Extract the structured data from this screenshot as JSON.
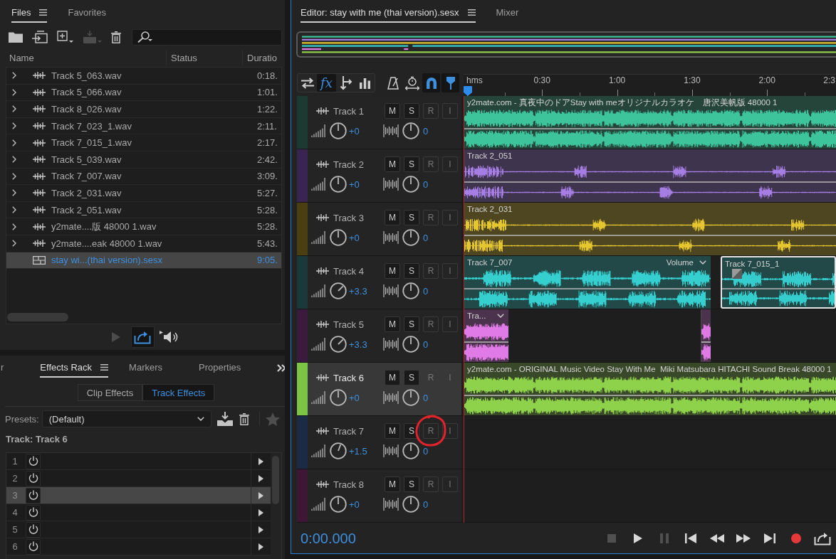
{
  "files_panel": {
    "tabs": [
      {
        "label": "Files",
        "selected": true
      },
      {
        "label": "Favorites",
        "selected": false
      }
    ],
    "toolbar": [
      {
        "kind": "open",
        "disabled": false
      },
      {
        "kind": "import",
        "disabled": false
      },
      {
        "kind": "new",
        "disabled": false
      },
      {
        "kind": "insert",
        "disabled": true
      },
      {
        "kind": "delete",
        "disabled": false
      }
    ],
    "columns": [
      "Name",
      "Status",
      "Duratio"
    ],
    "rows": [
      {
        "kind": "audio",
        "name": "Track 5_063.wav",
        "duration": "0:18.",
        "selected": false
      },
      {
        "kind": "audio",
        "name": "Track 5_066.wav",
        "duration": "1:01.",
        "selected": false
      },
      {
        "kind": "audio",
        "name": "Track 8_026.wav",
        "duration": "1:22.",
        "selected": false
      },
      {
        "kind": "audio",
        "name": "Track 7_023_1.wav",
        "duration": "2:11.",
        "selected": false
      },
      {
        "kind": "audio",
        "name": "Track 7_015_1.wav",
        "duration": "2:17.",
        "selected": false
      },
      {
        "kind": "audio",
        "name": "Track 5_039.wav",
        "duration": "2:42.",
        "selected": false
      },
      {
        "kind": "audio",
        "name": "Track 7_007.wav",
        "duration": "3:09.",
        "selected": false
      },
      {
        "kind": "audio",
        "name": "Track 2_031.wav",
        "duration": "5:27.",
        "selected": false
      },
      {
        "kind": "audio",
        "name": "Track 2_051.wav",
        "duration": "5:28.",
        "selected": false
      },
      {
        "kind": "audio",
        "name": "y2mate....版 48000 1.wav",
        "duration": "5:28.",
        "selected": false
      },
      {
        "kind": "audio",
        "name": "y2mate....eak 48000 1.wav",
        "duration": "5:43.",
        "selected": false
      },
      {
        "kind": "session",
        "name": "stay wi...(thai version).sesx",
        "duration": "9:05.",
        "selected": true
      }
    ],
    "preview_buttons": [
      {
        "kind": "play",
        "disabled": true,
        "selected": false
      },
      {
        "kind": "loop",
        "disabled": false,
        "selected": true
      },
      {
        "kind": "autoplay",
        "disabled": false,
        "selected": false
      }
    ]
  },
  "effects_panel": {
    "tabs": [
      {
        "label": "r",
        "selected": false
      },
      {
        "label": "Effects Rack",
        "selected": true
      },
      {
        "label": "Markers",
        "selected": false
      },
      {
        "label": "Properties",
        "selected": false
      }
    ],
    "modes": [
      {
        "label": "Clip Effects",
        "selected": false
      },
      {
        "label": "Track Effects",
        "selected": true
      }
    ],
    "presets": {
      "label": "Presets:",
      "value": "(Default)"
    },
    "target": "Track: Track 6",
    "slots": [
      {
        "number": "1",
        "selected": false
      },
      {
        "number": "2",
        "selected": false
      },
      {
        "number": "3",
        "selected": true
      },
      {
        "number": "4",
        "selected": false
      },
      {
        "number": "5",
        "selected": false
      },
      {
        "number": "6",
        "selected": false
      }
    ]
  },
  "editor": {
    "tabs": [
      {
        "label": "Editor: stay with me (thai version).sesx",
        "selected": true
      },
      {
        "label": "Mixer",
        "selected": false
      }
    ],
    "toolbar": [
      {
        "kind": "swap",
        "selected": false
      },
      {
        "kind": "fx",
        "label": "fx",
        "selected": true
      },
      {
        "kind": "send",
        "selected": false
      },
      {
        "kind": "eq",
        "selected": false
      },
      {
        "kind": "metronome",
        "selected": false
      },
      {
        "kind": "stretch",
        "selected": false
      },
      {
        "kind": "snap",
        "selected": true
      },
      {
        "kind": "marker",
        "selected": true
      }
    ],
    "ruler": [
      "hms",
      "0:30",
      "1:00",
      "1:30",
      "2:00",
      "2:3"
    ],
    "tracks": [
      {
        "name": "Track 1",
        "color": "#1b3a31",
        "selected": false,
        "buttons": [
          {
            "label": "M",
            "disabled": false,
            "circled": false
          },
          {
            "label": "S",
            "disabled": false,
            "circled": false
          },
          {
            "label": "R",
            "disabled": true,
            "circled": false
          },
          {
            "label": "I",
            "disabled": true,
            "circled": false
          }
        ],
        "volume": "+0",
        "pan": "0",
        "clips": [
          {
            "title": "y2mate.com - 真夜中のドアStay with meオリジナルカラオケ　唐沢美帆版 48000 1",
            "color": "#3ec49b",
            "selected": false,
            "dropdown": false
          }
        ]
      },
      {
        "name": "Track 2",
        "color": "#3a2452",
        "selected": false,
        "buttons": [
          {
            "label": "M",
            "disabled": false,
            "circled": false
          },
          {
            "label": "S",
            "disabled": false,
            "circled": false
          },
          {
            "label": "R",
            "disabled": true,
            "circled": false
          },
          {
            "label": "I",
            "disabled": true,
            "circled": false
          }
        ],
        "volume": "+0",
        "pan": "0",
        "clips": [
          {
            "title": "Track 2_051",
            "color": "#a57de3",
            "selected": false,
            "dropdown": false
          }
        ]
      },
      {
        "name": "Track 3",
        "color": "#4b3f12",
        "selected": false,
        "buttons": [
          {
            "label": "M",
            "disabled": false,
            "circled": false
          },
          {
            "label": "S",
            "disabled": false,
            "circled": false
          },
          {
            "label": "R",
            "disabled": true,
            "circled": false
          },
          {
            "label": "I",
            "disabled": true,
            "circled": false
          }
        ],
        "volume": "+0",
        "pan": "0",
        "clips": [
          {
            "title": "Track 2_031",
            "color": "#e6c62e",
            "selected": false,
            "dropdown": false
          }
        ]
      },
      {
        "name": "Track 4",
        "color": "#1a3a3a",
        "selected": false,
        "buttons": [
          {
            "label": "M",
            "disabled": false,
            "circled": false
          },
          {
            "label": "S",
            "disabled": false,
            "circled": false
          },
          {
            "label": "R",
            "disabled": true,
            "circled": false
          },
          {
            "label": "I",
            "disabled": true,
            "circled": false
          }
        ],
        "volume": "+3.3",
        "pan": "0",
        "clips": [
          {
            "title": "Track 7_007",
            "color": "#35cfcf",
            "selected": false,
            "dropdown": true,
            "envelope_label": "Volume"
          },
          {
            "title": "Track 7_015_1",
            "color": "#35cfcf",
            "selected": true,
            "dropdown": false
          }
        ]
      },
      {
        "name": "Track 5",
        "color": "#3b1b3d",
        "selected": false,
        "buttons": [
          {
            "label": "M",
            "disabled": false,
            "circled": false
          },
          {
            "label": "S",
            "disabled": false,
            "circled": false
          },
          {
            "label": "R",
            "disabled": true,
            "circled": false
          },
          {
            "label": "I",
            "disabled": true,
            "circled": false
          }
        ],
        "volume": "+3.3",
        "pan": "0",
        "clips": [
          {
            "title": "Tra...",
            "color": "#e07ae6",
            "selected": false,
            "dropdown": true
          },
          {
            "color": "#e07ae6",
            "selected": false,
            "dropdown": false
          }
        ]
      },
      {
        "name": "Track 6",
        "color": "#7cc544",
        "selected": true,
        "buttons": [
          {
            "label": "M",
            "disabled": false,
            "circled": false
          },
          {
            "label": "S",
            "disabled": false,
            "circled": false
          },
          {
            "label": "R",
            "disabled": true,
            "circled": false
          },
          {
            "label": "I",
            "disabled": true,
            "circled": false
          }
        ],
        "volume": "+0",
        "pan": "0",
        "clips": [
          {
            "title": "y2mate.com - ORIGINAL Music Video Stay With Me  Miki Matsubara HITACHI Sound Break 48000 1",
            "color": "#8ed24b",
            "selected": false,
            "dropdown": false
          }
        ]
      },
      {
        "name": "Track 7",
        "color": "#1b2b45",
        "selected": false,
        "buttons": [
          {
            "label": "M",
            "disabled": false,
            "circled": false
          },
          {
            "label": "S",
            "disabled": false,
            "circled": false
          },
          {
            "label": "R",
            "disabled": true,
            "circled": true
          },
          {
            "label": "I",
            "disabled": true,
            "circled": false
          }
        ],
        "volume": "+1.5",
        "pan": "0"
      },
      {
        "name": "Track 8",
        "color": "#3e1636",
        "selected": false,
        "buttons": [
          {
            "label": "M",
            "disabled": false,
            "circled": false
          },
          {
            "label": "S",
            "disabled": false,
            "circled": false
          },
          {
            "label": "R",
            "disabled": true,
            "circled": false
          },
          {
            "label": "I",
            "disabled": true,
            "circled": false
          }
        ],
        "volume": "+0",
        "pan": "0"
      }
    ],
    "time": "0:00.000",
    "transport": [
      {
        "kind": "stop",
        "disabled": true
      },
      {
        "kind": "play",
        "disabled": false
      },
      {
        "kind": "pause",
        "disabled": true
      },
      {
        "kind": "start",
        "disabled": false
      },
      {
        "kind": "rewind",
        "disabled": false
      },
      {
        "kind": "forward",
        "disabled": false
      },
      {
        "kind": "end",
        "disabled": false
      },
      {
        "kind": "record",
        "disabled": false
      },
      {
        "kind": "output",
        "disabled": false
      }
    ]
  }
}
